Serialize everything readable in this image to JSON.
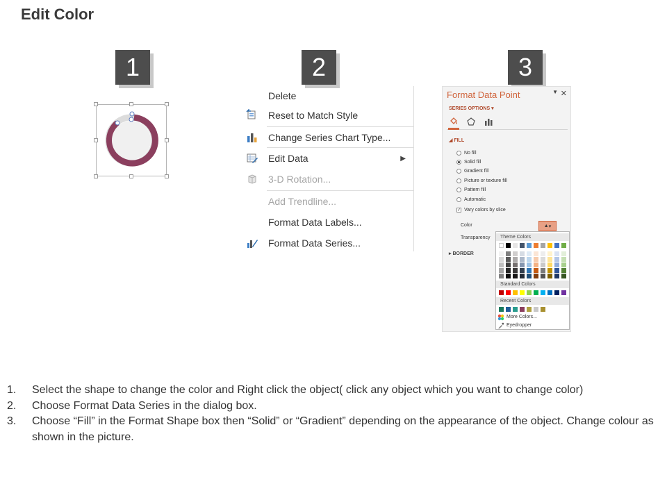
{
  "title": "Edit Color",
  "steps": [
    "1",
    "2",
    "3"
  ],
  "colors": {
    "ring": "#8b3f5e",
    "badge": "#4d4d4d",
    "accent": "#d0643c"
  },
  "context_menu": {
    "items": [
      {
        "label": "Delete",
        "icon": "",
        "disabled": false
      },
      {
        "label": "Reset to Match Style",
        "icon": "reset-style-icon",
        "disabled": false
      },
      {
        "label": "Change Series Chart Type...",
        "icon": "bar-chart-icon",
        "disabled": false
      },
      {
        "label": "Edit Data",
        "icon": "edit-data-icon",
        "disabled": false,
        "submenu": true
      },
      {
        "label": "3-D Rotation...",
        "icon": "cube-icon",
        "disabled": true
      },
      {
        "label": "Add Trendline...",
        "icon": "",
        "disabled": true
      },
      {
        "label": "Format Data Labels...",
        "icon": "",
        "disabled": false
      },
      {
        "label": "Format Data Series...",
        "icon": "format-series-icon",
        "disabled": false
      }
    ]
  },
  "format_pane": {
    "title": "Format Data Point",
    "series_options": "SERIES OPTIONS",
    "fill_section": "FILL",
    "fill_options": [
      {
        "label": "No fill",
        "checked": false
      },
      {
        "label": "Solid fill",
        "checked": true
      },
      {
        "label": "Gradient fill",
        "checked": false
      },
      {
        "label": "Picture or texture fill",
        "checked": false
      },
      {
        "label": "Pattern fill",
        "checked": false
      },
      {
        "label": "Automatic",
        "checked": false
      }
    ],
    "vary_colors": "Vary colors by slice",
    "color_label": "Color",
    "transparency_label": "Transparency",
    "border_section": "BORDER"
  },
  "color_picker": {
    "theme_header": "Theme Colors",
    "standard_header": "Standard Colors",
    "recent_header": "Recent Colors",
    "theme_top": [
      "#ffffff",
      "#000000",
      "#e7e6e6",
      "#44546a",
      "#5b9bd5",
      "#ed7d31",
      "#a5a5a5",
      "#ffc000",
      "#4472c4",
      "#70ad47"
    ],
    "theme_shades": [
      [
        "#f2f2f2",
        "#7f7f7f",
        "#d0cece",
        "#d6dce4",
        "#deebf6",
        "#fbe5d5",
        "#ededed",
        "#fff2cc",
        "#d9e2f3",
        "#e2efd9"
      ],
      [
        "#d8d8d8",
        "#595959",
        "#aeabab",
        "#adb9ca",
        "#bdd7ee",
        "#f7cbac",
        "#dbdbdb",
        "#fee599",
        "#b4c6e7",
        "#c5e0b3"
      ],
      [
        "#bfbfbf",
        "#3f3f3f",
        "#757070",
        "#8496b0",
        "#9dc3e6",
        "#f4b183",
        "#c9c9c9",
        "#ffd965",
        "#8eaadb",
        "#a8d08d"
      ],
      [
        "#a5a5a5",
        "#262626",
        "#3a3838",
        "#323f4f",
        "#2e75b5",
        "#c55a11",
        "#7b7b7b",
        "#bf9000",
        "#2f5496",
        "#538135"
      ],
      [
        "#7f7f7f",
        "#0c0c0c",
        "#171616",
        "#222a35",
        "#1e4e79",
        "#833c0b",
        "#525252",
        "#7f6000",
        "#1f3864",
        "#375623"
      ]
    ],
    "standard": [
      "#c00000",
      "#ff0000",
      "#ffc000",
      "#ffff00",
      "#92d050",
      "#00b050",
      "#00b0f0",
      "#0070c0",
      "#002060",
      "#7030a0"
    ],
    "recent": [
      "#1a7a5e",
      "#1f5c99",
      "#2a9d8f",
      "#8b3f5e",
      "#b0a040",
      "#c8c8c8",
      "#a89030"
    ],
    "more_colors": "More Colors...",
    "eyedropper": "Eyedropper"
  },
  "instructions": [
    {
      "num": "1.",
      "text": "Select the shape to change the color and Right click the object( click any object which you want to change color)"
    },
    {
      "num": "2.",
      "text": "Choose Format Data Series in the dialog box."
    },
    {
      "num": "3.",
      "text": "Choose “Fill” in the Format Shape box then “Solid” or “Gradient” depending on the appearance of the object. Change colour as shown in the picture."
    }
  ]
}
